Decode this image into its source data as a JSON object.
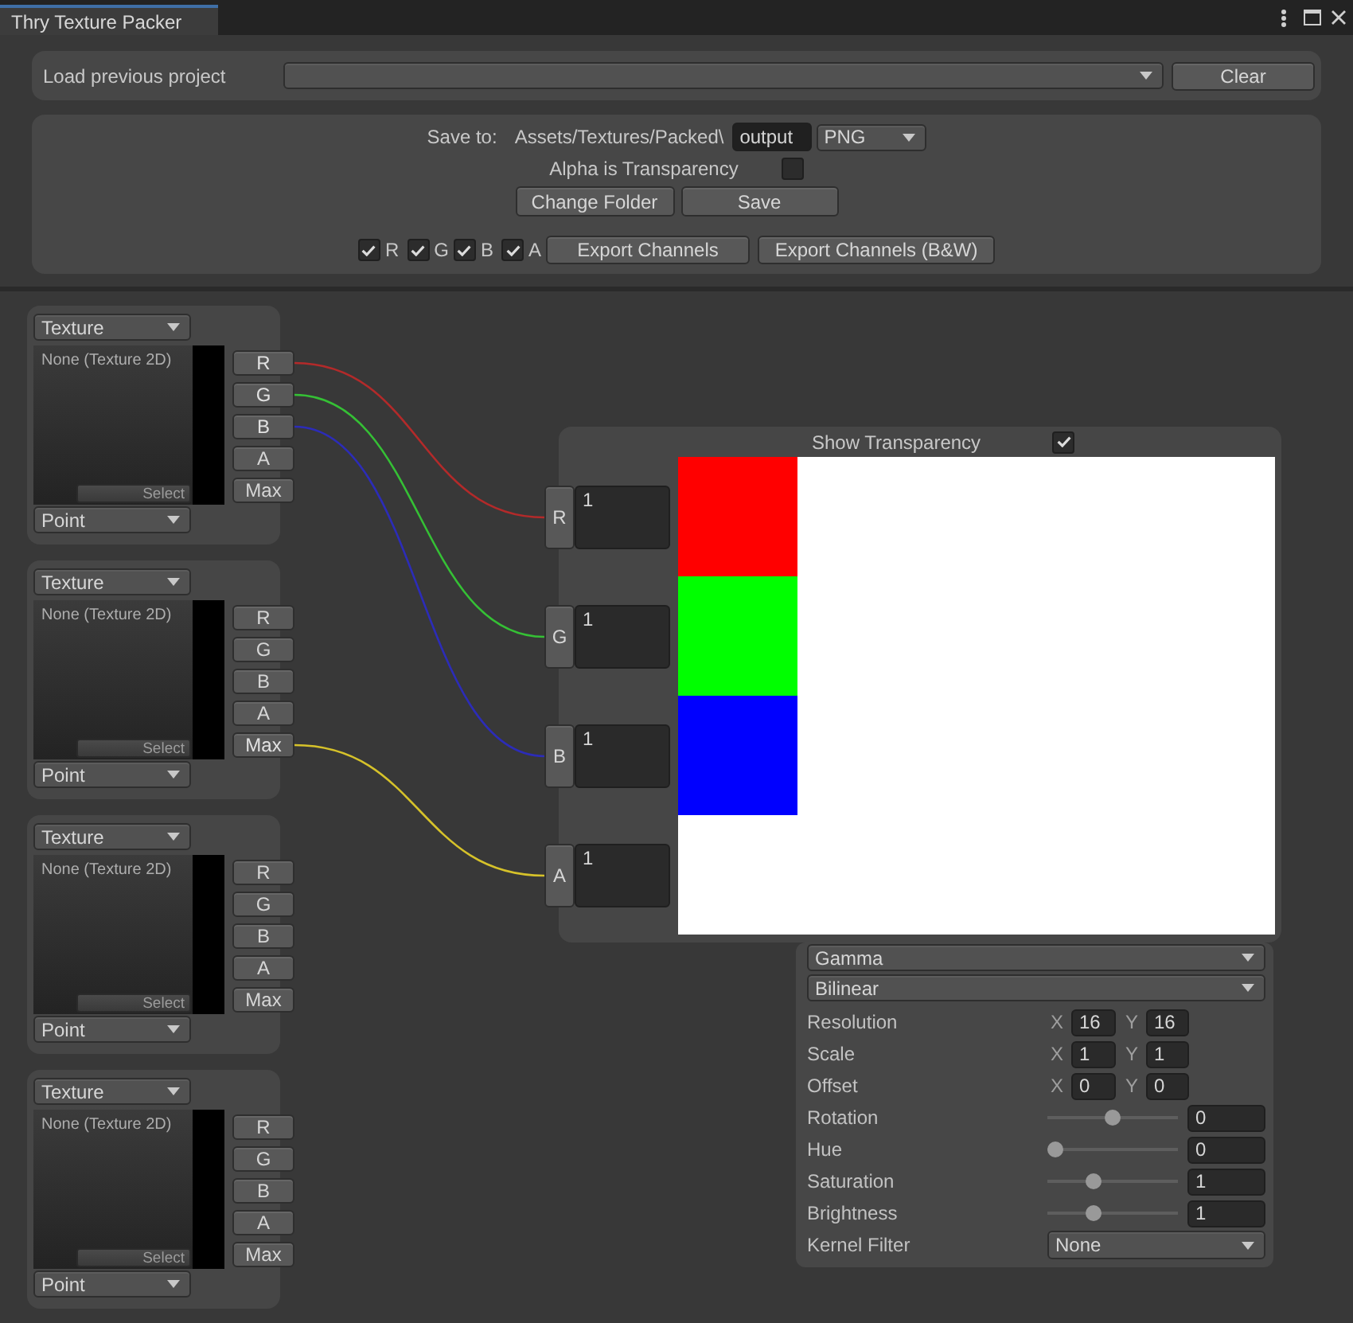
{
  "window": {
    "title": "Thry Texture Packer"
  },
  "load_project": {
    "label": "Load previous project",
    "clear_button": "Clear"
  },
  "save": {
    "label": "Save to:",
    "folder": "Assets/Textures/Packed\\",
    "file_name": "output",
    "format": "PNG",
    "alpha_is_transparency": {
      "label": "Alpha is Transparency",
      "checked": false
    },
    "buttons": [
      "Change Folder",
      "Save"
    ],
    "channels": [
      {
        "label": "R",
        "checked": true
      },
      {
        "label": "G",
        "checked": true
      },
      {
        "label": "B",
        "checked": true
      },
      {
        "label": "A",
        "checked": true
      }
    ],
    "export_buttons": [
      "Export Channels",
      "Export Channels (B&W)"
    ]
  },
  "inputs": [
    {
      "source": "Texture",
      "texture": "None (Texture 2D)",
      "select_button": "Select",
      "filter": "Point",
      "channels": [
        {
          "label": "R",
          "connected": true
        },
        {
          "label": "G",
          "connected": true
        },
        {
          "label": "B",
          "connected": true
        },
        {
          "label": "A",
          "connected": false
        },
        {
          "label": "Max",
          "connected": false
        }
      ]
    },
    {
      "source": "Texture",
      "texture": "None (Texture 2D)",
      "select_button": "Select",
      "filter": "Point",
      "channels": [
        {
          "label": "R",
          "connected": false
        },
        {
          "label": "G",
          "connected": false
        },
        {
          "label": "B",
          "connected": false
        },
        {
          "label": "A",
          "connected": false
        },
        {
          "label": "Max",
          "connected": true
        }
      ]
    },
    {
      "source": "Texture",
      "texture": "None (Texture 2D)",
      "select_button": "Select",
      "filter": "Point",
      "channels": [
        {
          "label": "R",
          "connected": false
        },
        {
          "label": "G",
          "connected": false
        },
        {
          "label": "B",
          "connected": false
        },
        {
          "label": "A",
          "connected": false
        },
        {
          "label": "Max",
          "connected": false
        }
      ]
    },
    {
      "source": "Texture",
      "texture": "None (Texture 2D)",
      "select_button": "Select",
      "filter": "Point",
      "channels": [
        {
          "label": "R",
          "connected": false
        },
        {
          "label": "G",
          "connected": false
        },
        {
          "label": "B",
          "connected": false
        },
        {
          "label": "A",
          "connected": false
        },
        {
          "label": "Max",
          "connected": false
        }
      ]
    }
  ],
  "output": {
    "show_transparency": {
      "label": "Show Transparency",
      "checked": true
    },
    "channels": [
      {
        "label": "R",
        "value": "1",
        "color": "#b32a2a"
      },
      {
        "label": "G",
        "value": "1",
        "color": "#35c035"
      },
      {
        "label": "B",
        "value": "1",
        "color": "#2c2cb8"
      },
      {
        "label": "A",
        "value": "1",
        "color": "#d6c22a"
      }
    ]
  },
  "settings": {
    "color_space": "Gamma",
    "filter": "Bilinear",
    "vectors": [
      {
        "label": "Resolution",
        "fields": [
          {
            "axis": "X",
            "value": "16"
          },
          {
            "axis": "Y",
            "value": "16"
          }
        ]
      },
      {
        "label": "Scale",
        "fields": [
          {
            "axis": "X",
            "value": "1"
          },
          {
            "axis": "Y",
            "value": "1"
          }
        ]
      },
      {
        "label": "Offset",
        "fields": [
          {
            "axis": "X",
            "value": "0"
          },
          {
            "axis": "Y",
            "value": "0"
          }
        ]
      }
    ],
    "sliders": [
      {
        "label": "Rotation",
        "level": 0.5,
        "value": "0"
      },
      {
        "label": "Hue",
        "level": 0,
        "value": "0"
      },
      {
        "label": "Saturation",
        "level": 0.33,
        "value": "1"
      },
      {
        "label": "Brightness",
        "level": 0.33,
        "value": "1"
      }
    ],
    "kernel_filter": {
      "label": "Kernel Filter",
      "value": "None"
    }
  }
}
